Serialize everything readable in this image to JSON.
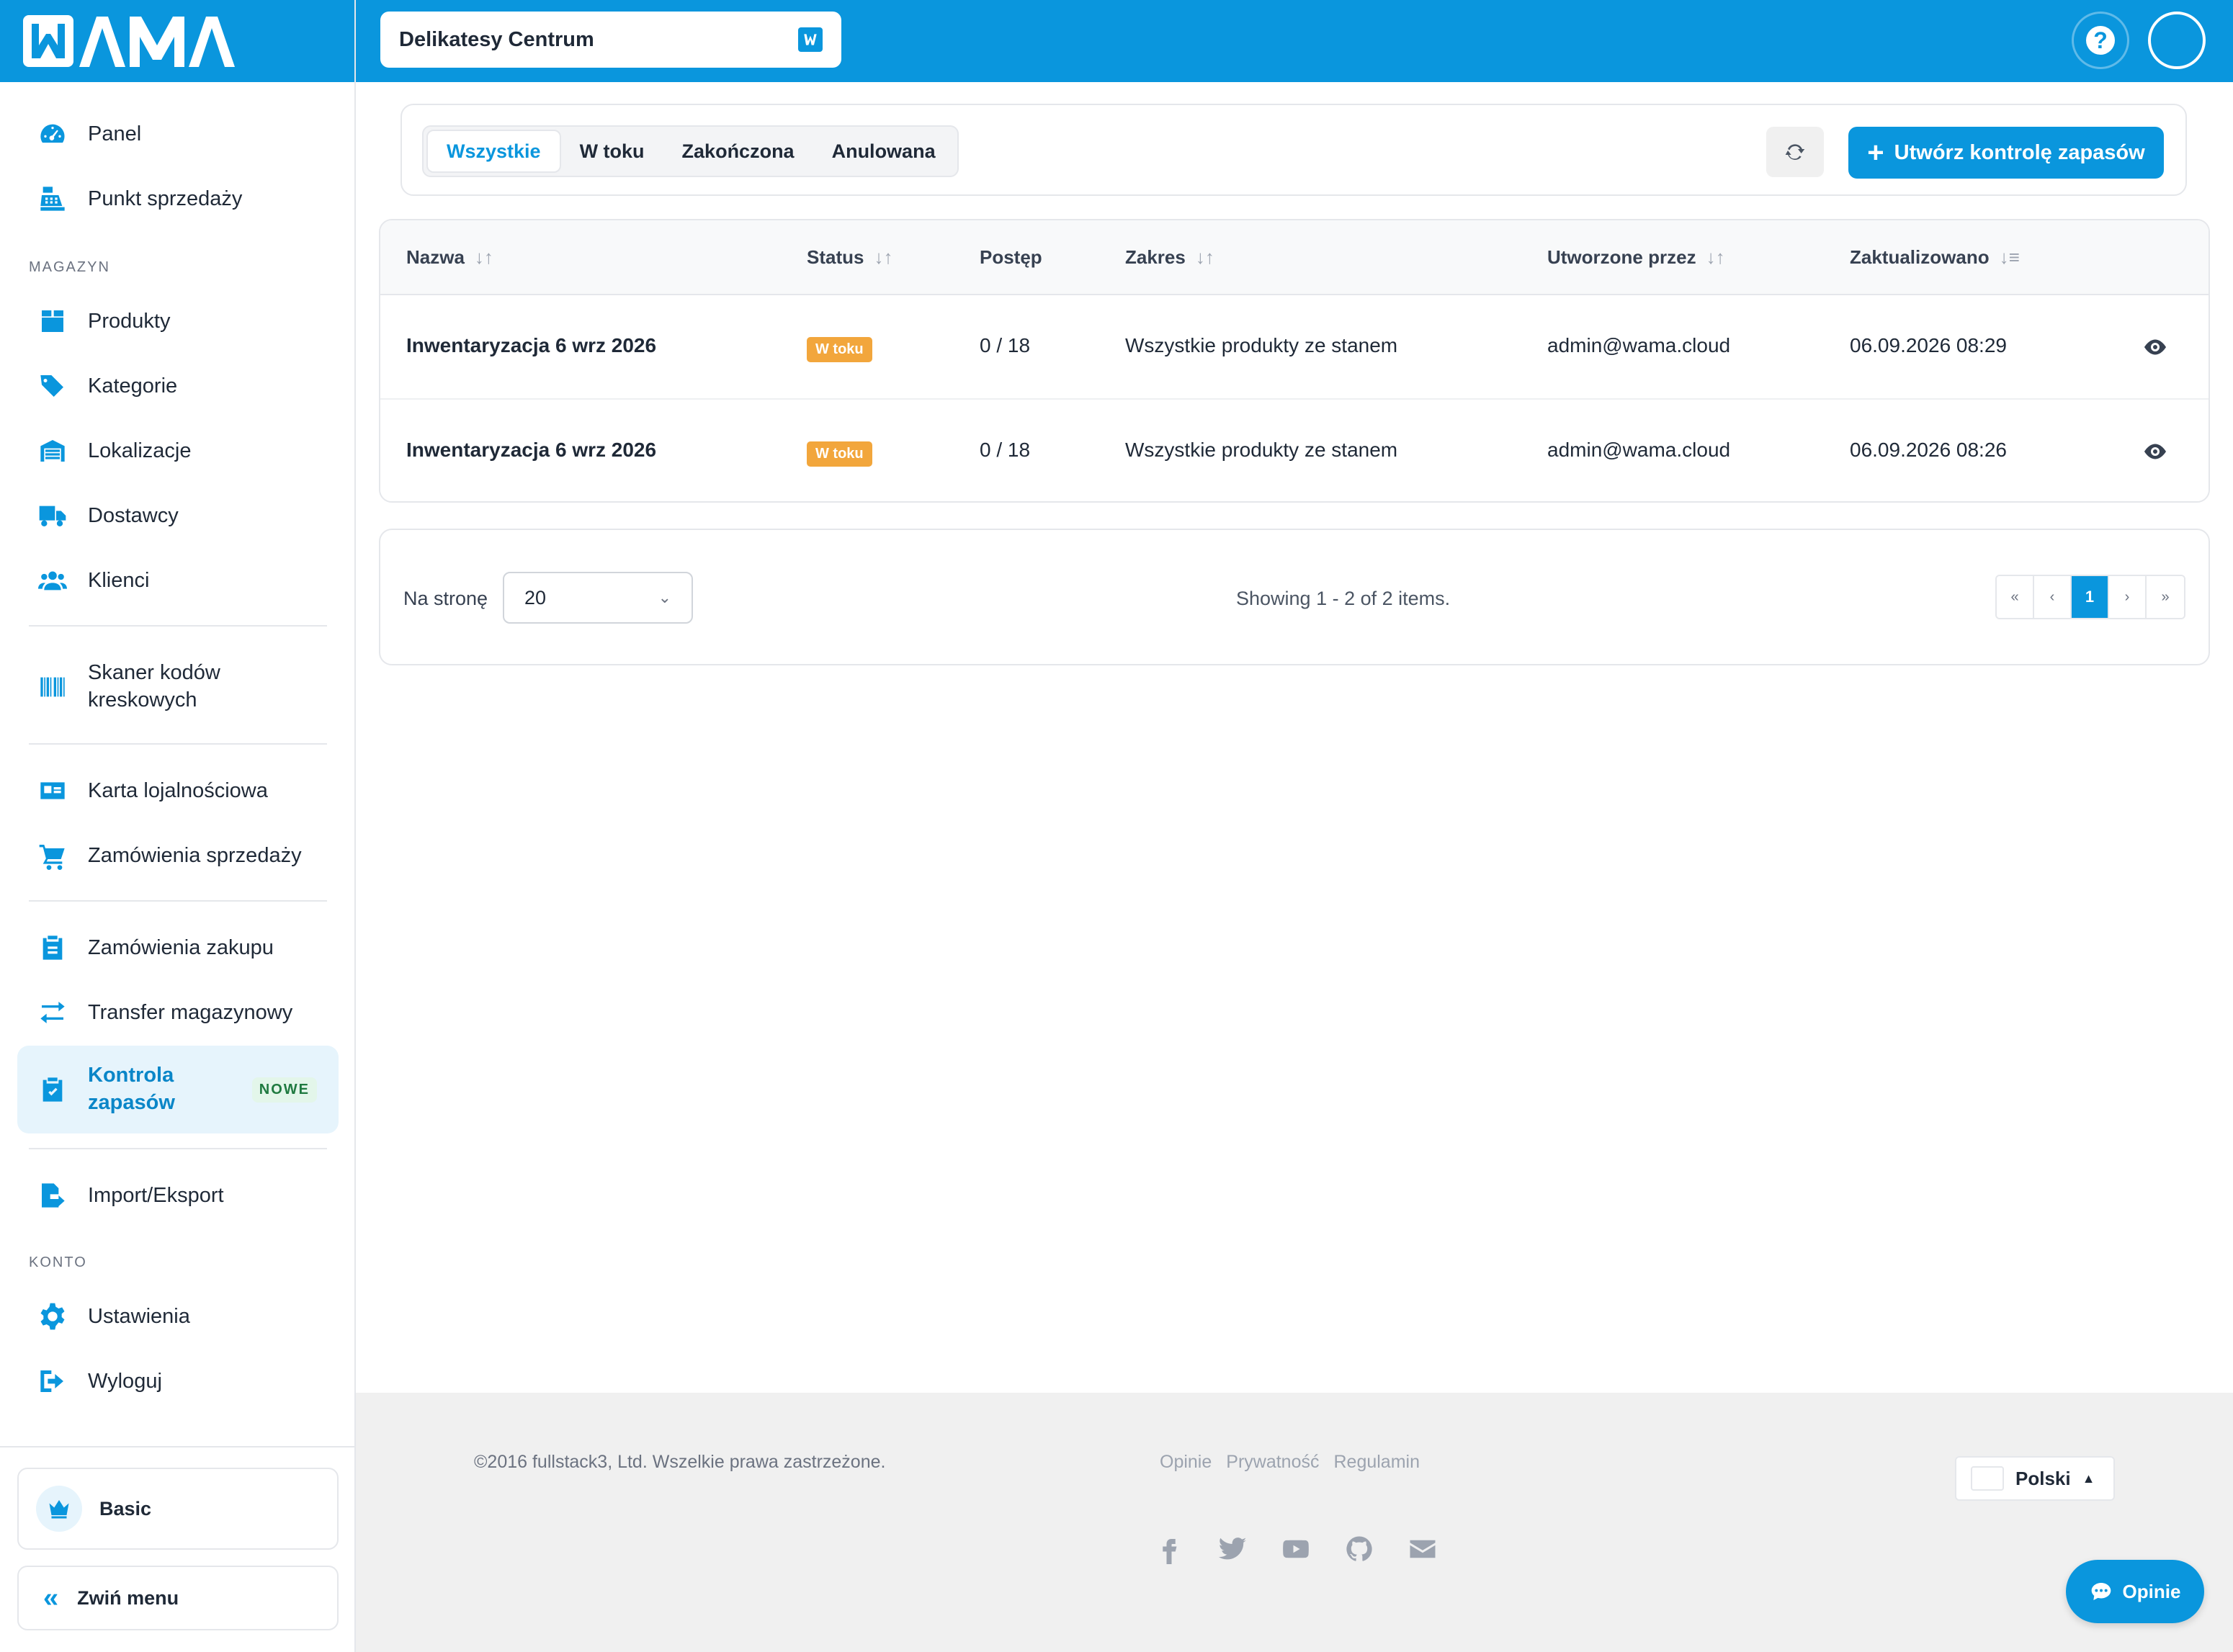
{
  "brand": {
    "logo_text": "WAMA",
    "accent": "#0a96dd"
  },
  "sidebar": {
    "items": [
      {
        "label": "Panel",
        "icon": "gauge-icon"
      },
      {
        "label": "Punkt sprzedaży",
        "icon": "cash-register-icon"
      }
    ],
    "section_magazyn": "MAGAZYN",
    "magazyn_items": [
      {
        "label": "Produkty",
        "icon": "box-icon"
      },
      {
        "label": "Kategorie",
        "icon": "tags-icon"
      },
      {
        "label": "Lokalizacje",
        "icon": "warehouse-icon"
      },
      {
        "label": "Dostawcy",
        "icon": "truck-icon"
      },
      {
        "label": "Klienci",
        "icon": "users-icon"
      }
    ],
    "scanner_label": "Skaner kodów kreskowych",
    "loyalty_label": "Karta lojalnościowa",
    "sales_orders_label": "Zamówienia sprzedaży",
    "purchase_orders_label": "Zamówienia zakupu",
    "transfer_label": "Transfer magazynowy",
    "stock_control_label": "Kontrola zapasów",
    "stock_control_badge": "NOWE",
    "import_export_label": "Import/Eksport",
    "section_konto": "KONTO",
    "settings_label": "Ustawienia",
    "logout_label": "Wyloguj",
    "plan_label": "Basic",
    "collapse_label": "Zwiń menu"
  },
  "topbar": {
    "store_name": "Delikatesy Centrum"
  },
  "filters": {
    "tabs": [
      "Wszystkie",
      "W toku",
      "Zakończona",
      "Anulowana"
    ],
    "active_tab": "Wszystkie",
    "create_button": "Utwórz kontrolę zapasów"
  },
  "table": {
    "columns": {
      "name": "Nazwa",
      "status": "Status",
      "progress": "Postęp",
      "scope": "Zakres",
      "created_by": "Utworzone przez",
      "updated": "Zaktualizowano"
    },
    "rows": [
      {
        "name": "Inwentaryzacja 6 wrz 2026",
        "status": "W toku",
        "progress": "0 / 18",
        "scope": "Wszystkie produkty ze stanem",
        "created_by": "admin@wama.cloud",
        "updated": "06.09.2026 08:29"
      },
      {
        "name": "Inwentaryzacja 6 wrz 2026",
        "status": "W toku",
        "progress": "0 / 18",
        "scope": "Wszystkie produkty ze stanem",
        "created_by": "admin@wama.cloud",
        "updated": "06.09.2026 08:26"
      }
    ]
  },
  "pager": {
    "per_page_label": "Na stronę",
    "per_page_value": "20",
    "showing": "Showing 1 - 2 of 2 items.",
    "first": "«",
    "prev": "‹",
    "current": "1",
    "next": "›",
    "last": "»"
  },
  "footer": {
    "copyright": "©2016 fullstack3, Ltd. Wszelkie prawa zastrzeżone.",
    "links": [
      "Opinie",
      "Prywatność",
      "Regulamin"
    ],
    "language": "Polski",
    "feedback_button": "Opinie"
  }
}
